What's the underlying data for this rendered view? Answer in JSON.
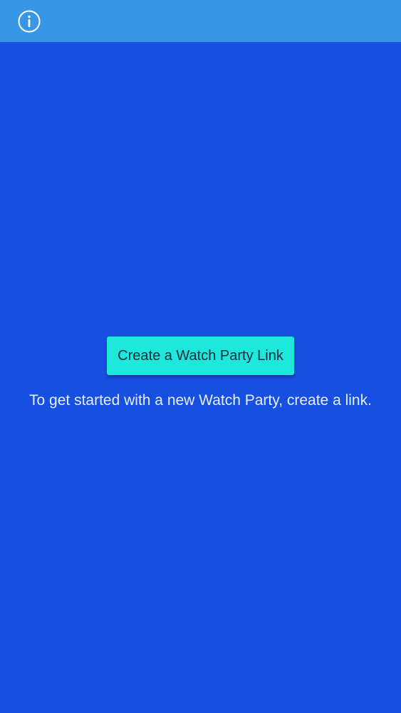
{
  "header": {
    "info_icon": "info-icon"
  },
  "main": {
    "create_button_label": "Create a Watch Party Link",
    "help_text": "To get started with a new Watch Party, create a link."
  },
  "colors": {
    "header_bg": "#3796E6",
    "page_bg": "#1650E0",
    "button_bg": "#1EE8DC",
    "help_text": "#E8EEFF"
  }
}
